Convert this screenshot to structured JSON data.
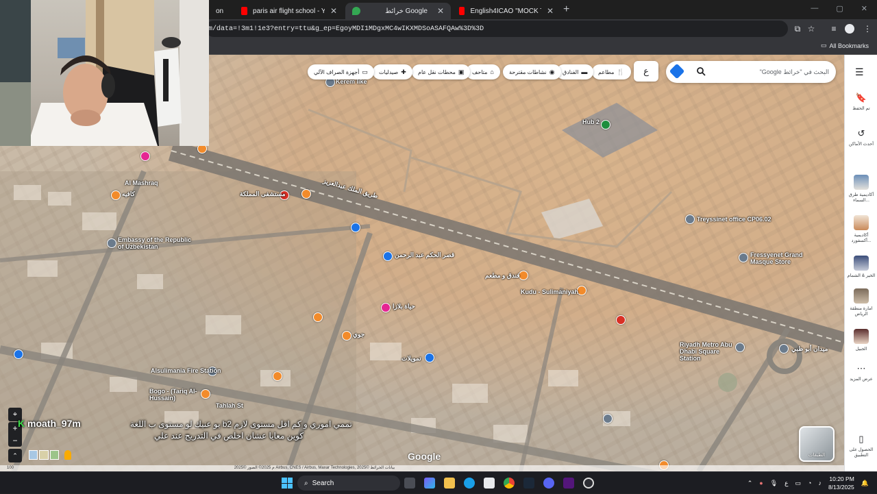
{
  "browser": {
    "tabs": [
      {
        "title": "on",
        "favicon_color": "#ff0000"
      },
      {
        "title": "paris air flight school - YouTube",
        "favicon_color": "#ff0000"
      },
      {
        "title": "خرائط Google",
        "favicon_color": "#34a853"
      },
      {
        "title": "English4ICAO \"MOCK TEST\" - Y",
        "favicon_color": "#ff0000"
      }
    ],
    "url": "m/data=!3m1!1e3?entry=ttu&g_ep=EgoyMDI1MDgxMC4wIKXMDSoASAFQAw%3D%3D",
    "all_bookmarks": "All Bookmarks"
  },
  "maps": {
    "search_placeholder": "البحث في \"خرائط Google\"",
    "lang_button": "ع",
    "chips": [
      {
        "label": "مطاعم",
        "icon": "fork-knife-icon"
      },
      {
        "label": "الفنادق",
        "icon": "bed-icon"
      },
      {
        "label": "نشاطات مقترحة",
        "icon": "camera-icon"
      },
      {
        "label": "متاحف",
        "icon": "museum-icon"
      },
      {
        "label": "محطات نقل عام",
        "icon": "train-icon"
      },
      {
        "label": "صيدليات",
        "icon": "pill-icon"
      },
      {
        "label": "أجهزة الصراف الآلي",
        "icon": "atm-icon"
      }
    ],
    "rail": [
      {
        "label": "تم الحفظ",
        "icon": "bookmark-icon"
      },
      {
        "label": "أحدث الأماكن",
        "icon": "history-icon"
      },
      {
        "label": "أكاديمية طرق السماء..."
      },
      {
        "label": "أكاديمية أكسفورد..."
      },
      {
        "label": "الخير & الشمام"
      },
      {
        "label": "امارة منطقة الرياض"
      },
      {
        "label": "الجبيل"
      },
      {
        "label": "عرض المزيد",
        "icon": "more-icon"
      },
      {
        "label": "الحصول على التطبيق",
        "icon": "phone-icon"
      }
    ],
    "layers_label": "الطبقات",
    "google_logo": "Google",
    "footer": "2025© الصور ©2025 Airbus, CNES / Airbus, Maxar Technologies, 2025© بيانات الخرائط",
    "scale": "100 م",
    "places": [
      {
        "name": "Kerem like",
        "color": "gray"
      },
      {
        "name": "Hub 2",
        "color": "green"
      },
      {
        "name": "Al Mashraq",
        "color": "none"
      },
      {
        "name": "Embassy of the Republic of Uzbekistan",
        "color": "gray"
      },
      {
        "name": "Treyssinet office CP06.02",
        "color": "gray"
      },
      {
        "name": "Fressyenet Grand Masque Store",
        "color": "gray"
      },
      {
        "name": "Kudu - Sulimaniyah",
        "color": "orange"
      },
      {
        "name": "Riyadh Metro Abu Dhabi Square Station",
        "color": "gray"
      },
      {
        "name": "Alsulimania Fire Station",
        "color": "gray"
      },
      {
        "name": "Bogo - (Tariq Al-Hussain)",
        "color": "orange"
      },
      {
        "name": "Tahlah St",
        "color": "none"
      },
      {
        "name": "طريق الملك عبدالعزيز",
        "color": "none"
      },
      {
        "name": "مستشفى المملكة",
        "color": "red"
      },
      {
        "name": "ميدان أبو ظبي",
        "color": "gray"
      },
      {
        "name": "قصر الحكم عبد الرحمن",
        "color": "blue"
      },
      {
        "name": "فندق و مطعم",
        "color": "orange"
      },
      {
        "name": "كافيه",
        "color": "orange"
      },
      {
        "name": "جوي",
        "color": "orange"
      },
      {
        "name": "حياة بلازا",
        "color": "pink"
      },
      {
        "name": "تمويلات",
        "color": "blue"
      }
    ]
  },
  "stream": {
    "username": "moath_97m",
    "username_prefix": "K",
    "subtitle_line1": "تممي اموري و كم اقل مستوى لازم b2 يو عنيك لو مستوى ب اللغة",
    "subtitle_line2": "كوين معايا عشان اخلص في التدريج عند علي"
  },
  "taskbar": {
    "search_label": "Search",
    "lang": "ع",
    "time": "10:20 PM",
    "date": "8/13/2025"
  }
}
